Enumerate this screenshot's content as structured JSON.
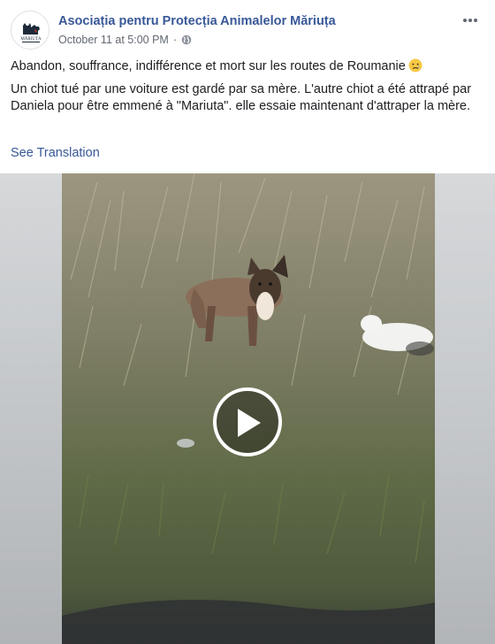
{
  "post": {
    "page_name": "Asociația pentru Protecția Animalelor Măriuța",
    "timestamp": "October 11 at 5:00 PM",
    "separator": "·",
    "privacy_icon": "globe-icon",
    "avatar_logo_text": "MĂRIUȚA",
    "more_icon": "more-dots-icon",
    "paragraph_1": "Abandon, souffrance, indifférence et mort sur les routes de Roumanie",
    "emoji": "sad-tear-emoji",
    "paragraph_2": "Un chiot tué par une voiture est gardé par sa mère. L'autre chiot a été attrapé par Daniela pour être emmené à \"Mariuta\". elle essaie maintenant d'attraper la mère.",
    "see_translation": "See Translation"
  },
  "video": {
    "play_icon": "play-icon"
  },
  "colors": {
    "link": "#385898",
    "text": "#1c1e21",
    "meta": "#616770"
  }
}
